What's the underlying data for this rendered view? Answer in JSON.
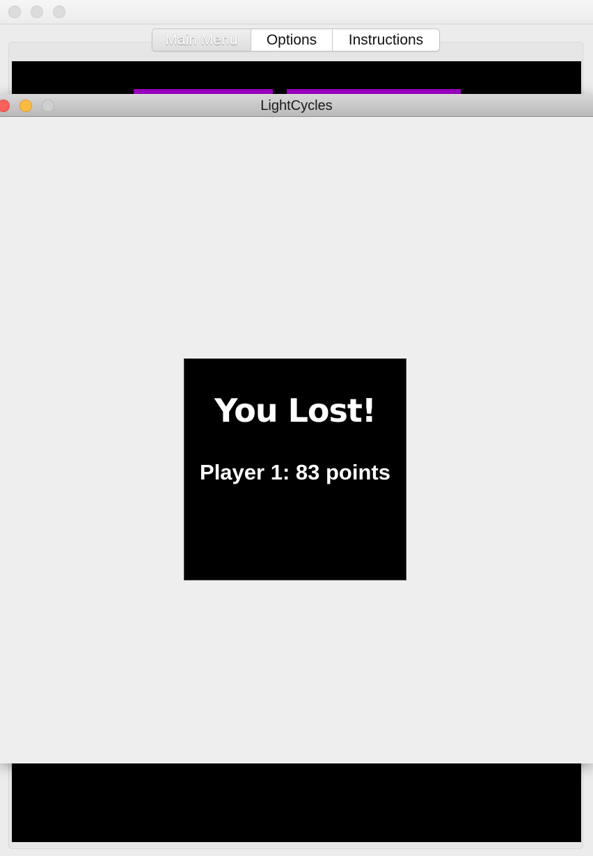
{
  "background_window": {
    "tabs": [
      {
        "label": "Main Menu",
        "selected": true
      },
      {
        "label": "Options",
        "selected": false
      },
      {
        "label": "Instructions",
        "selected": false
      }
    ],
    "banner_color": "#a400cc"
  },
  "dialog": {
    "title": "LightCycles",
    "result_heading": "You Lost!",
    "result_score": "Player 1: 83 points"
  },
  "colors": {
    "close": "#fc605b",
    "minimize": "#fdbc40",
    "zoom_inactive": "#d0d0d0",
    "card_background": "#000000",
    "card_text": "#ffffff"
  },
  "icons": [
    "close-icon",
    "minimize-icon",
    "zoom-icon"
  ]
}
